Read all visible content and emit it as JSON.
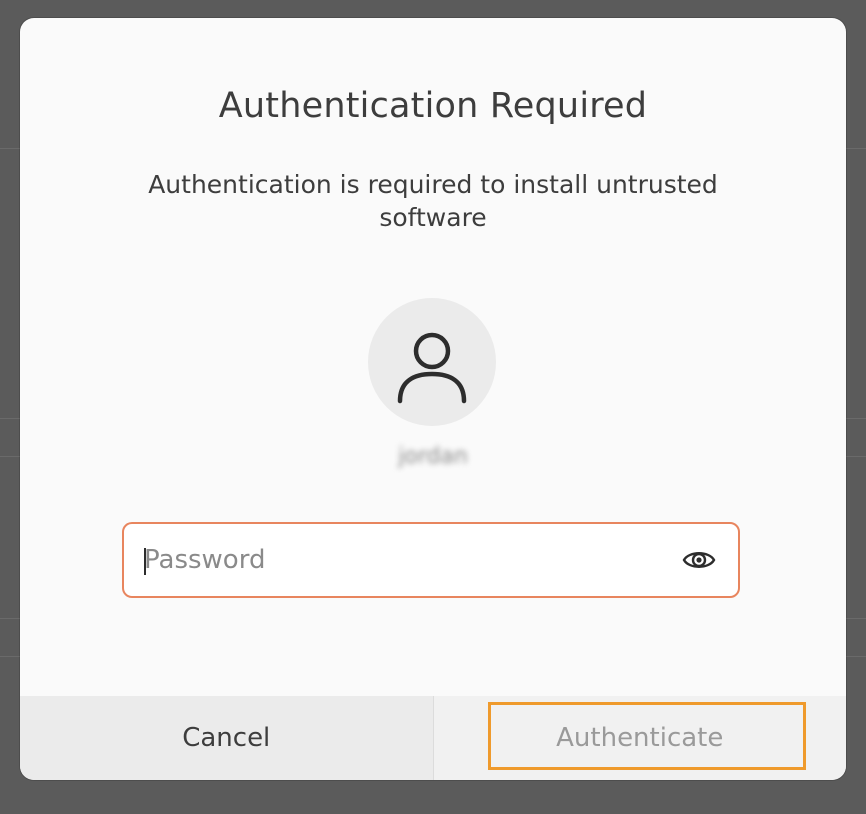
{
  "dialog": {
    "title": "Authentication Required",
    "message_line1": "Authentication is required to install untrusted",
    "message_line2": "software"
  },
  "user": {
    "name": "jordan",
    "avatar_icon": "user-avatar-icon"
  },
  "password": {
    "placeholder": "Password",
    "value": "",
    "reveal_icon": "eye-icon"
  },
  "buttons": {
    "cancel_label": "Cancel",
    "authenticate_label": "Authenticate"
  },
  "colors": {
    "field_border": "#e8855e",
    "focus_ring": "#ef9a2c",
    "disabled_text": "#9a9a9a"
  }
}
